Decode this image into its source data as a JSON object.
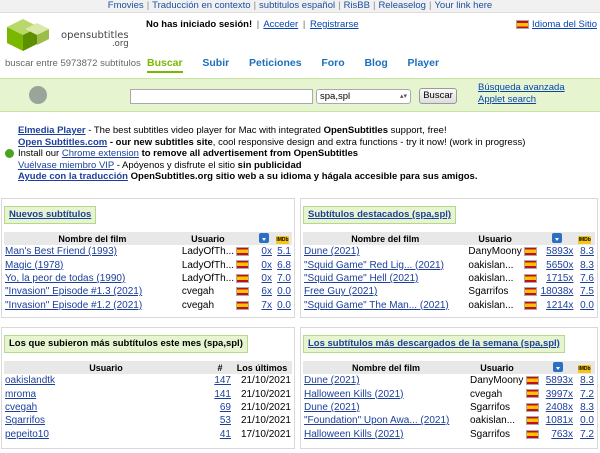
{
  "topbar": {
    "links": [
      "Fmovies",
      "Traducción en contexto",
      "subtitulos español",
      "RisBB",
      "Releaselog",
      "Your link here"
    ]
  },
  "header": {
    "logo_text": "opensubtitles",
    "logo_org": ".org",
    "search_count": "buscar entre 5973872 subtítulos",
    "login_status": "No has iniciado sesión!",
    "login_link": "Acceder",
    "register_link": "Registrarse",
    "language_link": "Idioma del Sitio",
    "nav": [
      "Buscar",
      "Subir",
      "Peticiones",
      "Foro",
      "Blog",
      "Player"
    ]
  },
  "search": {
    "query": "",
    "language_value": "spa,spl",
    "button": "Buscar",
    "advanced": "Búsqueda avanzada",
    "applet": "Applet search"
  },
  "notices": [
    {
      "link": "Elmedia Player",
      "text": " - The best subtitles video player for Mac with integrated ",
      "bold": "OpenSubtitles",
      "text2": " support, free!"
    },
    {
      "link": "Open Subtitles.com",
      "text": " - our new subtitles site",
      "text2": ", cool responsive design and extra functions - try it now! (work in progress)"
    },
    {
      "pre": "Install our ",
      "link": "Chrome extension",
      "text": " to remove all advertisement from OpenSubtitles"
    },
    {
      "link": "Vuélvase miembro VIP",
      "text": " - Apóyenos y disfrute el sitio ",
      "bold": "sin publicidad"
    },
    {
      "link": "Ayude con la traducción",
      "text": " OpenSubtitles.org sitio web a su idioma y hágala accesible para sus amigos."
    }
  ],
  "panels": {
    "new_subs": {
      "title": "Nuevos subtítulos",
      "headers": [
        "Nombre del film",
        "Usuario"
      ],
      "rows": [
        {
          "film": "Man's Best Friend (1993)",
          "user": "LadyOfTh...",
          "count": "0x",
          "rating": "5.1"
        },
        {
          "film": "Magic (1978)",
          "user": "LadyOfTh...",
          "count": "0x",
          "rating": "6.8"
        },
        {
          "film": "Yo, la peor de todas (1990)",
          "user": "LadyOfTh...",
          "count": "0x",
          "rating": "7.0"
        },
        {
          "film": "\"Invasion\" Episode #1.3 (2021)",
          "user": "cvegah",
          "count": "6x",
          "rating": "0.0"
        },
        {
          "film": "\"Invasion\" Episode #1.2 (2021)",
          "user": "cvegah",
          "count": "7x",
          "rating": "0.0"
        }
      ]
    },
    "featured": {
      "title": "Subtítulos destacados (spa,spl)",
      "headers": [
        "Nombre del film",
        "Usuario"
      ],
      "rows": [
        {
          "film": "Dune (2021)",
          "user": "DanyMoony",
          "count": "5893x",
          "rating": "8.3"
        },
        {
          "film": "\"Squid Game\" Red Lig... (2021)",
          "user": "oakislan...",
          "count": "5650x",
          "rating": "8.3"
        },
        {
          "film": "\"Squid Game\" Hell (2021)",
          "user": "oakislan...",
          "count": "1715x",
          "rating": "7.6"
        },
        {
          "film": "Free Guy (2021)",
          "user": "Sgarrifos",
          "count": "18038x",
          "rating": "7.5"
        },
        {
          "film": "\"Squid Game\" The Man... (2021)",
          "user": "oakislan...",
          "count": "1214x",
          "rating": "0.0"
        }
      ]
    },
    "top_uploaders": {
      "title": "Los que subieron más subtítulos este mes (spa,spl)",
      "headers": [
        "Usuario",
        "#",
        "Los últimos"
      ],
      "rows": [
        {
          "user": "oakislandtk",
          "count": "147",
          "date": "21/10/2021"
        },
        {
          "user": "mroma",
          "count": "141",
          "date": "21/10/2021"
        },
        {
          "user": "cvegah",
          "count": "69",
          "date": "21/10/2021"
        },
        {
          "user": "Sgarrifos",
          "count": "53",
          "date": "21/10/2021"
        },
        {
          "user": "pepeito10",
          "count": "41",
          "date": "17/10/2021"
        }
      ]
    },
    "most_downloaded": {
      "title": "Los subtítulos más descargados de la semana (spa,spl)",
      "headers": [
        "Nombre del film",
        "Usuario"
      ],
      "rows": [
        {
          "film": "Dune (2021)",
          "user": "DanyMoony",
          "count": "5893x",
          "rating": "8.3"
        },
        {
          "film": "Halloween Kills (2021)",
          "user": "cvegah",
          "count": "3997x",
          "rating": "7.2"
        },
        {
          "film": "Dune (2021)",
          "user": "Sgarrifos",
          "count": "2408x",
          "rating": "8.3"
        },
        {
          "film": "\"Foundation\" Upon Awa... (2021)",
          "user": "oakislan...",
          "count": "1081x",
          "rating": "0.0"
        },
        {
          "film": "Halloween Kills (2021)",
          "user": "Sgarrifos",
          "count": "763x",
          "rating": "7.2"
        }
      ]
    }
  },
  "colors": {
    "brand_green": "#7ab800",
    "link_blue": "#1d3f9c",
    "panel_bg": "#e6f5d0"
  },
  "icons": [
    "logo-icon",
    "spain-flag-icon",
    "download-icon",
    "imdb-icon",
    "chrome-icon",
    "search-bar-icon"
  ]
}
